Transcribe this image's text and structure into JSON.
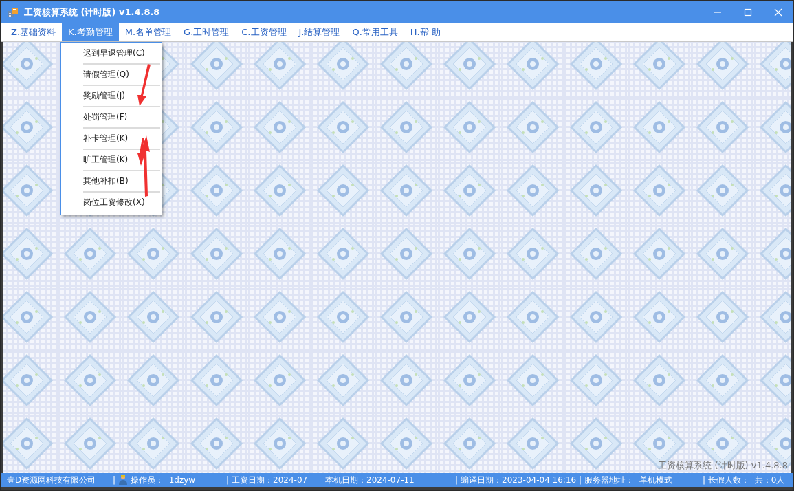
{
  "window": {
    "title": "工资核算系统 (计时版) v1.4.8.8"
  },
  "menu": [
    {
      "label": "Z.基础资料",
      "selected": false
    },
    {
      "label": "K.考勤管理",
      "selected": true
    },
    {
      "label": "M.名单管理",
      "selected": false
    },
    {
      "label": "G.工时管理",
      "selected": false
    },
    {
      "label": "C.工资管理",
      "selected": false
    },
    {
      "label": "J.结算管理",
      "selected": false
    },
    {
      "label": "Q.常用工具",
      "selected": false
    },
    {
      "label": "H.帮 助",
      "selected": false
    }
  ],
  "dropdown": {
    "items": [
      "迟到早退管理(C)",
      "请假管理(Q)",
      "奖励管理(J)",
      "处罚管理(F)",
      "补卡管理(K)",
      "旷工管理(K)",
      "其他补扣(B)",
      "岗位工资修改(X)"
    ]
  },
  "annotation_arrows": [
    {
      "kind": "down"
    },
    {
      "kind": "down"
    },
    {
      "kind": "up"
    }
  ],
  "watermark": "工资核算系统 (计时版) v1.4.8.8",
  "status_bar": [
    {
      "text": "壹D资源网科技有限公司",
      "kind": "plain"
    },
    {
      "text": "操作员：  1dzyw",
      "kind": "user",
      "lead": "|"
    },
    {
      "text": "工资日期：2024-07",
      "kind": "divided",
      "lead": "|"
    },
    {
      "text": "本机日期：2024-07-11",
      "kind": "plain"
    },
    {
      "text": "编译日期：2023-04-04 16:16",
      "kind": "divided",
      "lead": "|"
    },
    {
      "text": "服务器地址：  单机模式",
      "kind": "divided",
      "lead": "|"
    },
    {
      "text": "长假人数：  共：0人",
      "kind": "divided",
      "lead": "|"
    }
  ]
}
